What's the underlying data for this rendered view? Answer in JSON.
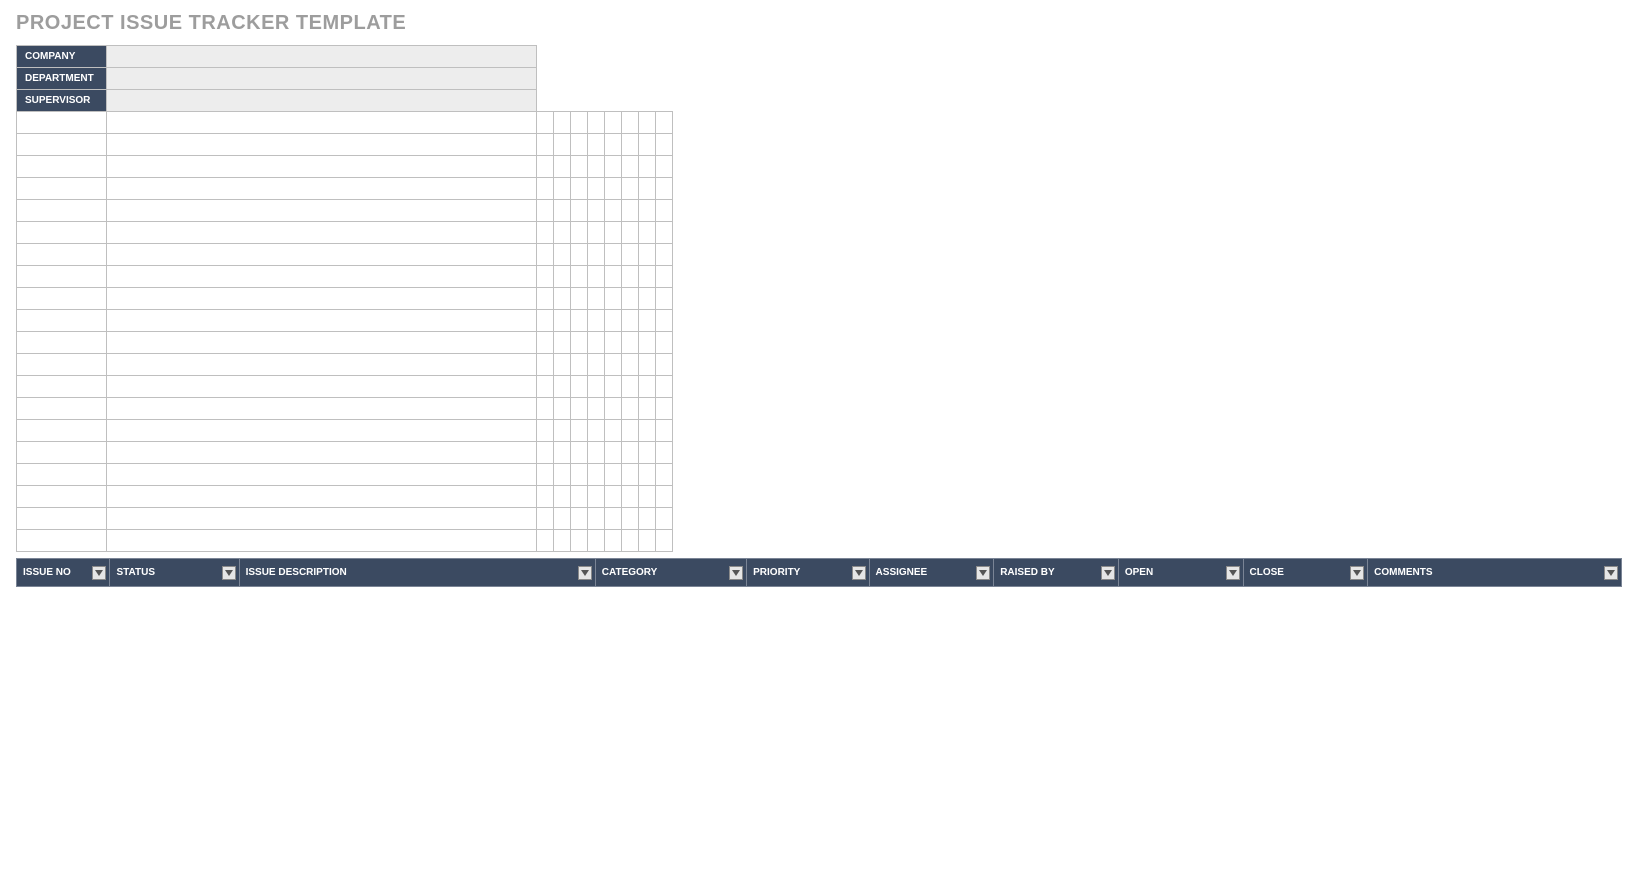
{
  "title": "PROJECT ISSUE TRACKER TEMPLATE",
  "meta": {
    "company_label": "COMPANY",
    "company_value": "",
    "department_label": "DEPARTMENT",
    "department_value": "",
    "supervisor_label": "SUPERVISOR",
    "supervisor_value": ""
  },
  "columns": {
    "issue_no": "ISSUE NO",
    "status": "STATUS",
    "desc": "ISSUE DESCRIPTION",
    "category": "CATEGORY",
    "priority": "PRIORITY",
    "assignee": "ASSIGNEE",
    "raised": "RAISED BY",
    "open": "OPEN",
    "close": "CLOSE",
    "comments": "COMMENTS"
  },
  "row_count": 20
}
